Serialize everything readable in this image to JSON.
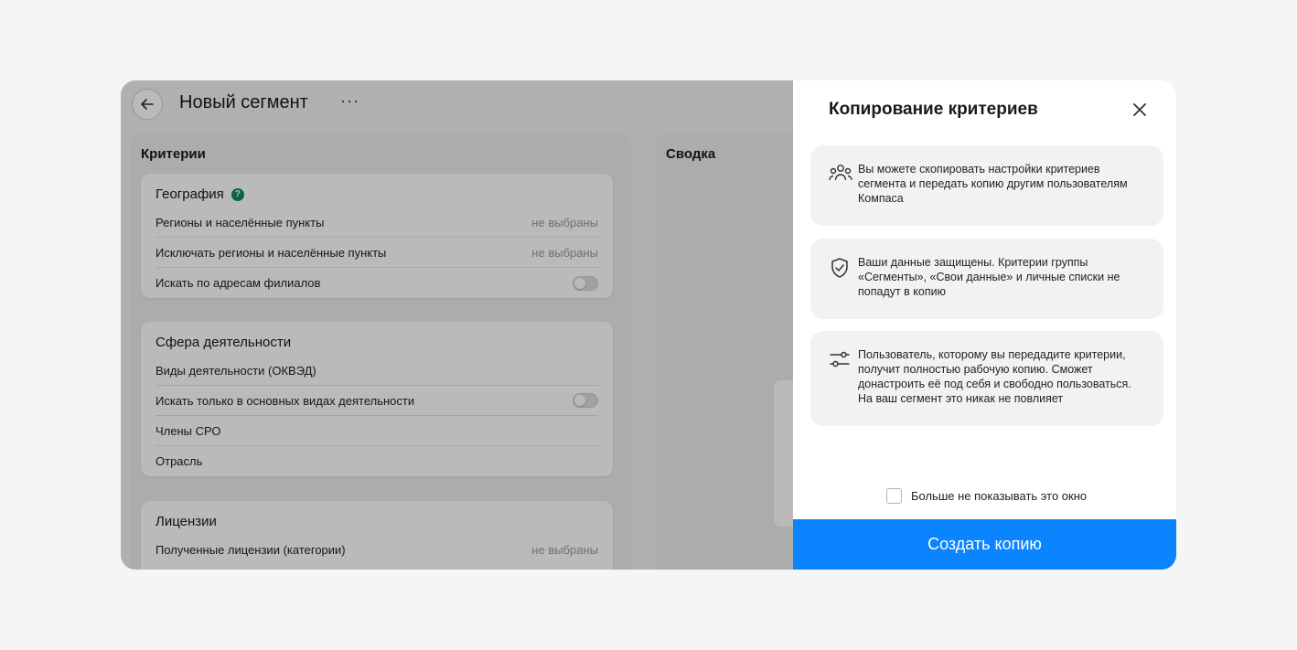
{
  "app": {
    "title": "Новый сегмент",
    "more_label": "···",
    "criteria_title": "Критерии",
    "summary_title": "Сводка",
    "sections": {
      "geo": {
        "title": "География",
        "rows": [
          {
            "label": "Регионы и населённые пункты",
            "value": "не выбраны"
          },
          {
            "label": "Исключать регионы и населённые пункты",
            "value": "не выбраны"
          },
          {
            "label": "Искать по адресам филиалов"
          }
        ]
      },
      "activity": {
        "title": "Сфера деятельности",
        "rows": [
          {
            "label": "Виды деятельности (ОКВЭД)"
          },
          {
            "label": "Искать только в основных видах деятельности"
          },
          {
            "label": "Члены СРО"
          },
          {
            "label": "Отрасль"
          }
        ]
      },
      "licenses": {
        "title": "Лицензии",
        "rows": [
          {
            "label": "Полученные лицензии (категории)",
            "value": "не выбраны"
          }
        ]
      }
    }
  },
  "modal": {
    "title": "Копирование критериев",
    "info": [
      {
        "icon": "users-icon",
        "text": "Вы можете скопировать настройки критериев сегмента и передать копию другим пользователям Компаса"
      },
      {
        "icon": "shield-check-icon",
        "text": "Ваши данные защищены. Критерии группы «Сегменты», «Свои данные» и личные списки не попадут в копию"
      },
      {
        "icon": "sliders-icon",
        "text": "Пользователь, которому вы передадите критерии, получит полностью рабочую копию. Сможет донастроить её под себя и свободно пользоваться. На ваш сегмент это никак не повлияет"
      }
    ],
    "dont_show_label": "Больше не показывать это окно",
    "cta_label": "Создать копию"
  },
  "colors": {
    "accent": "#0a84ff",
    "help_badge": "#0a8a5e"
  }
}
